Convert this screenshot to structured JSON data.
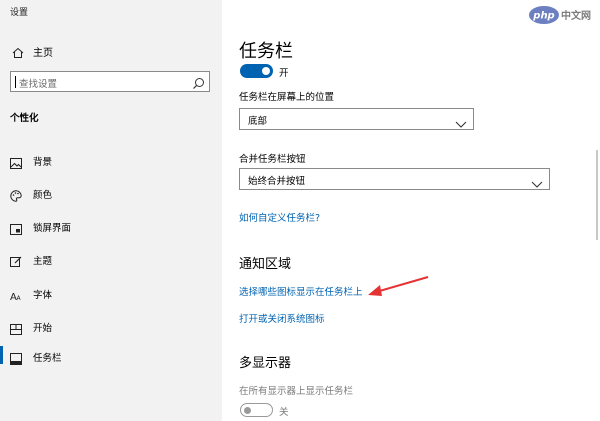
{
  "app": {
    "title": "设置"
  },
  "sidebar": {
    "home_label": "主页",
    "search_placeholder": "查找设置",
    "section_title": "个性化",
    "items": [
      {
        "label": "背景",
        "icon": "image-icon"
      },
      {
        "label": "颜色",
        "icon": "palette-icon"
      },
      {
        "label": "锁屏界面",
        "icon": "lock-screen-icon"
      },
      {
        "label": "主题",
        "icon": "theme-icon"
      },
      {
        "label": "字体",
        "icon": "font-icon"
      },
      {
        "label": "开始",
        "icon": "start-icon"
      },
      {
        "label": "任务栏",
        "icon": "taskbar-icon",
        "active": true
      }
    ]
  },
  "main": {
    "title": "任务栏",
    "top_toggle": {
      "state": "开",
      "on": true
    },
    "position_label": "任务栏在屏幕上的位置",
    "position_value": "底部",
    "combine_label": "合并任务栏按钮",
    "combine_value": "始终合并按钮",
    "customize_link": "如何自定义任务栏?",
    "notification_heading": "通知区域",
    "choose_icons_link": "选择哪些图标显示在任务栏上",
    "system_icons_link": "打开或关闭系统图标",
    "multi_display_heading": "多显示器",
    "show_all_label": "在所有显示器上显示任务栏",
    "bottom_toggle": {
      "state": "关",
      "on": false
    }
  },
  "watermark": {
    "text": "php 中文网"
  },
  "colors": {
    "accent": "#0063b1",
    "annotation_arrow": "#e53333",
    "sidebar_bg": "#f2f2f2"
  }
}
